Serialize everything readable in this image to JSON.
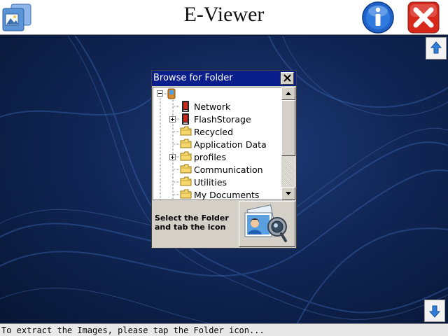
{
  "app": {
    "title": "E-Viewer"
  },
  "header": {
    "folder_icon": "folder-icon",
    "info_icon": "info-icon",
    "close_icon": "close-icon"
  },
  "scroll": {
    "up_icon": "arrow-up-icon",
    "down_icon": "arrow-down-icon"
  },
  "dialog": {
    "title": "Browse for Folder",
    "close_icon": "close-x-icon",
    "hint_line1": "Select the Folder",
    "hint_line2": "and tab the icon",
    "extract_icon": "image-extract-icon",
    "tree": {
      "root_icon": "device-icon",
      "items": [
        {
          "label": "Network",
          "icon": "storage-card-icon",
          "expandable": false
        },
        {
          "label": "FlashStorage",
          "icon": "storage-card-icon",
          "expandable": true
        },
        {
          "label": "Recycled",
          "icon": "folder-icon",
          "expandable": false
        },
        {
          "label": "Application Data",
          "icon": "folder-icon",
          "expandable": false
        },
        {
          "label": "profiles",
          "icon": "folder-icon",
          "expandable": true
        },
        {
          "label": "Communication",
          "icon": "folder-icon",
          "expandable": false
        },
        {
          "label": "Utilities",
          "icon": "folder-icon",
          "expandable": false
        },
        {
          "label": "My Documents",
          "icon": "folder-icon",
          "expandable": false
        }
      ]
    }
  },
  "status": {
    "text": "To extract the Images, please tap the Folder icon..."
  },
  "colors": {
    "titlebar": "#0a1e8c",
    "background": "#0b1a3a",
    "close_red": "#d8281c",
    "info_blue": "#1f62c8"
  }
}
